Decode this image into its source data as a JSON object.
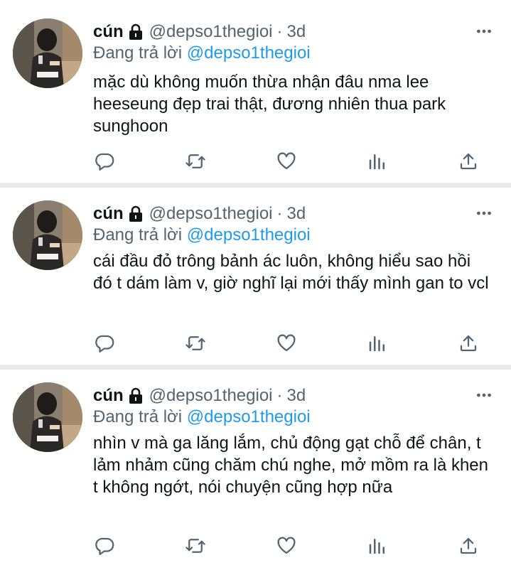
{
  "tweets": [
    {
      "name": "cún",
      "handle": "@depso1thegioi",
      "dot": "·",
      "time": "3d",
      "reply_prefix": "Đang trả lời",
      "reply_to": "@depso1thegioi",
      "text": "mặc dù không muốn thừa nhận đâu nma lee heeseung đẹp trai thật, đương nhiên thua park sunghoon"
    },
    {
      "name": "cún",
      "handle": "@depso1thegioi",
      "dot": "·",
      "time": "3d",
      "reply_prefix": "Đang trả lời",
      "reply_to": "@depso1thegioi",
      "text": "cái đầu đỏ trông bảnh ác luôn, không hiểu sao hồi đó t dám làm v, giờ nghĩ lại mới thấy mình gan to vcl"
    },
    {
      "name": "cún",
      "handle": "@depso1thegioi",
      "dot": "·",
      "time": "3d",
      "reply_prefix": "Đang trả lời",
      "reply_to": "@depso1thegioi",
      "text": "nhìn v mà ga lăng lắm, chủ động gạt  chỗ để chân, t lảm nhảm cũng chăm chú nghe, mở mồm ra là khen t không ngớt, nói chuyện cũng hợp nữa"
    }
  ],
  "icons": {
    "lock": "lock-icon",
    "more": "more-options-icon",
    "reply": "reply-icon",
    "retweet": "retweet-icon",
    "like": "heart-icon",
    "stats": "analytics-icon",
    "share": "share-icon"
  },
  "colors": {
    "text": "#0f1419",
    "secondary": "#536471",
    "link": "#1d9bf0",
    "divider": "#e6ecf0"
  }
}
